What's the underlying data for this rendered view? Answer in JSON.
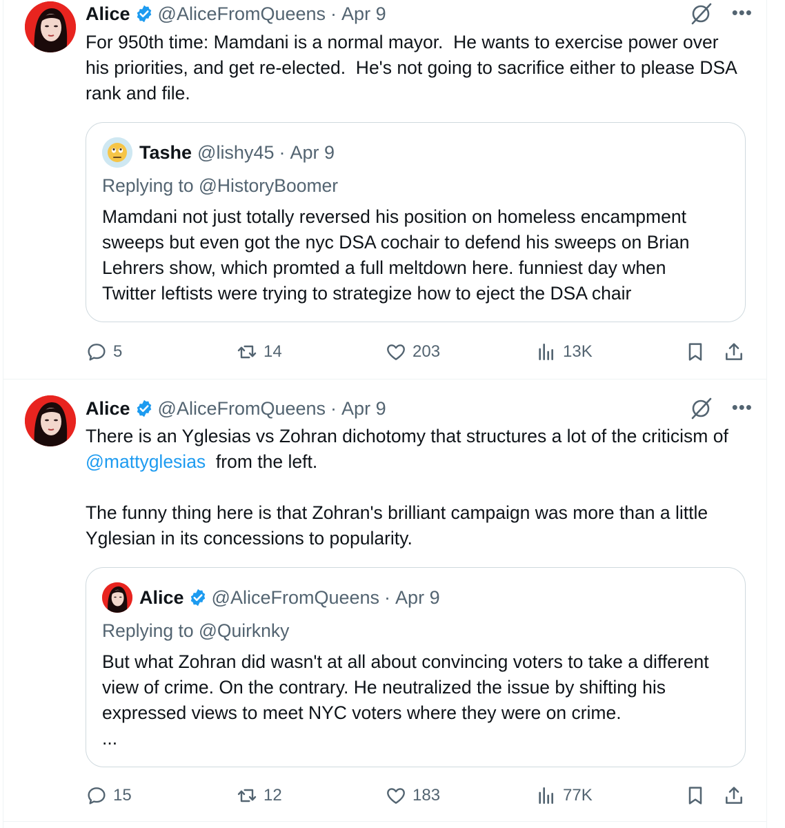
{
  "colors": {
    "accent": "#1d9bf0",
    "muted": "#536471",
    "text": "#0f1419",
    "border": "#cfd9de",
    "avatar_bg": "#e8241f"
  },
  "tweets": [
    {
      "author": {
        "name": "Alice",
        "handle": "@AliceFromQueens",
        "date": "Apr 9",
        "verified": true
      },
      "separator": "·",
      "text": "For 950th time: Mamdani is a normal mayor.  He wants to exercise power over\nhis priorities, and get re-elected.  He's not going to sacrifice either to please DSA\nrank and file.",
      "quote": {
        "author": {
          "name": "Tashe",
          "handle": "@lishy45",
          "date": "Apr 9",
          "avatar_icon": "face-emoji-avatar"
        },
        "replying_to": "Replying to @HistoryBoomer",
        "text": "Mamdani not just totally reversed his position on homeless encampment\nsweeps but even got the nyc DSA cochair to defend his sweeps on Brian\nLehrers show, which promted a full meltdown here. funniest day when\nTwitter leftists were trying to strategize how to eject the DSA chair"
      },
      "stats": {
        "replies": "5",
        "retweets": "14",
        "likes": "203",
        "views": "13K"
      }
    },
    {
      "author": {
        "name": "Alice",
        "handle": "@AliceFromQueens",
        "date": "Apr 9",
        "verified": true
      },
      "separator": "·",
      "text_line1": "There is an Yglesias vs Zohran dichotomy that structures a lot of the criticism of",
      "mention": "@mattyglesias",
      "text_line2_rest": "  from the left.",
      "text_para2": "The funny thing here is that Zohran's brilliant campaign was more than a little\nYglesian in its concessions to popularity.",
      "quote": {
        "author": {
          "name": "Alice",
          "handle": "@AliceFromQueens",
          "date": "Apr 9",
          "verified": true
        },
        "replying_to": "Replying to @Quirknky",
        "text": "But what Zohran did wasn't at all about convincing voters to take a different\nview of crime. On the contrary. He neutralized the issue by shifting his\nexpressed views to meet NYC voters where they were on crime.\n..."
      },
      "stats": {
        "replies": "15",
        "retweets": "12",
        "likes": "183",
        "views": "77K"
      }
    }
  ],
  "icons": [
    "reply-icon",
    "retweet-icon",
    "like-icon",
    "views-icon",
    "bookmark-icon",
    "share-icon",
    "grok-icon",
    "more-icon",
    "verified-badge-icon"
  ]
}
